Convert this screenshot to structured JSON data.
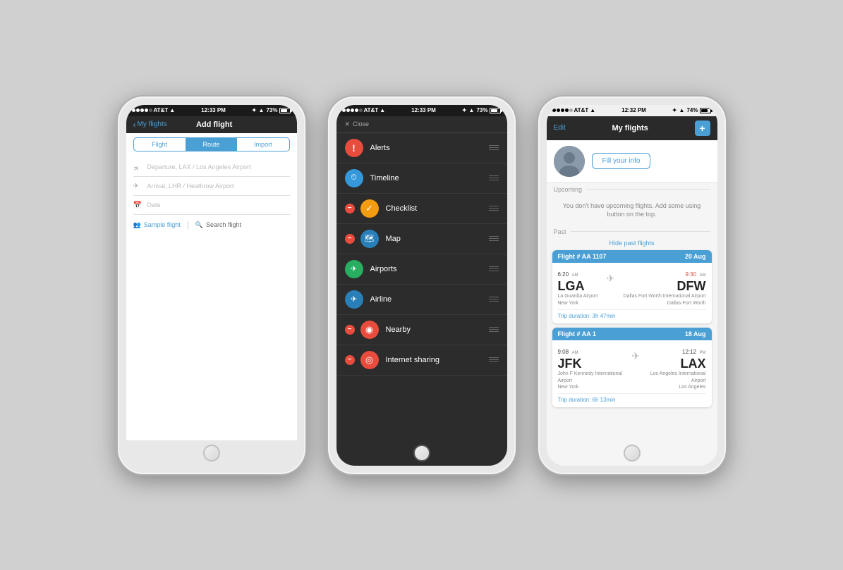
{
  "phone1": {
    "status": {
      "carrier": "AT&T",
      "time": "12:33 PM",
      "battery": "73%",
      "wifi": true
    },
    "nav": {
      "back_label": "My flights",
      "title": "Add flight"
    },
    "tabs": [
      "Flight",
      "Route",
      "Import"
    ],
    "active_tab": 1,
    "fields": [
      {
        "icon": "✈",
        "placeholder": "Departure, LAX / Los Angeles Airport"
      },
      {
        "icon": "✈",
        "placeholder": "Arrival, LHR / Heathrow Airport"
      },
      {
        "icon": "📅",
        "placeholder": "Date"
      }
    ],
    "actions": {
      "sample_label": "Sample flight",
      "search_label": "Search flight"
    }
  },
  "phone2": {
    "status": {
      "carrier": "AT&T",
      "time": "12:33 PM",
      "battery": "73%"
    },
    "close_label": "Close",
    "menu_items": [
      {
        "id": "alerts",
        "label": "Alerts",
        "color": "#e74c3c",
        "icon": "!",
        "has_minus": false
      },
      {
        "id": "timeline",
        "label": "Timeline",
        "color": "#3498db",
        "icon": "⏱",
        "has_minus": false
      },
      {
        "id": "checklist",
        "label": "Checklist",
        "color": "#f39c12",
        "icon": "✓",
        "has_minus": true
      },
      {
        "id": "map",
        "label": "Map",
        "color": "#2980b9",
        "icon": "🗺",
        "has_minus": true
      },
      {
        "id": "airports",
        "label": "Airports",
        "color": "#27ae60",
        "icon": "✈",
        "has_minus": false
      },
      {
        "id": "airline",
        "label": "Airline",
        "color": "#2980b9",
        "icon": "✈",
        "has_minus": false
      },
      {
        "id": "nearby",
        "label": "Nearby",
        "color": "#e74c3c",
        "icon": "◉",
        "has_minus": true
      },
      {
        "id": "internet",
        "label": "Internet sharing",
        "color": "#e74c3c",
        "icon": "◎",
        "has_minus": true
      }
    ]
  },
  "phone3": {
    "status": {
      "carrier": "AT&T",
      "time": "12:32 PM",
      "battery": "74%"
    },
    "nav": {
      "edit_label": "Edit",
      "title": "My flights",
      "plus_label": "+"
    },
    "profile": {
      "fill_info_label": "Fill your info"
    },
    "upcoming_label": "Upcoming",
    "upcoming_msg": "You don't have upcoming flights. Add some using button on the top.",
    "past_label": "Past",
    "hide_past_label": "Hide past flights",
    "flights": [
      {
        "flight_number": "Flight # AA 1107",
        "date": "20 Aug",
        "dep_time": "6:20",
        "dep_ampm": "AM",
        "arr_time": "9:30",
        "arr_ampm": "AM",
        "arr_late": true,
        "dep_code": "LGA",
        "dep_airport": "La Guardia Airport",
        "dep_city": "New York",
        "arr_code": "DFW",
        "arr_airport": "Dallas Fort Worth\nInternational Airport",
        "arr_city": "Dallas-Fort Worth",
        "duration": "Trip duration: 3h 47min"
      },
      {
        "flight_number": "Flight # AA 1",
        "date": "18 Aug",
        "dep_time": "9:08",
        "dep_ampm": "AM",
        "arr_time": "12:12",
        "arr_ampm": "PM",
        "arr_late": false,
        "dep_code": "JFK",
        "dep_airport": "John F Kennedy\nInternational Airport",
        "dep_city": "New York",
        "arr_code": "LAX",
        "arr_airport": "Los Angeles\nInternational Airport",
        "arr_city": "Los Angeles",
        "duration": "Trip duration: 6h 13min"
      }
    ]
  }
}
